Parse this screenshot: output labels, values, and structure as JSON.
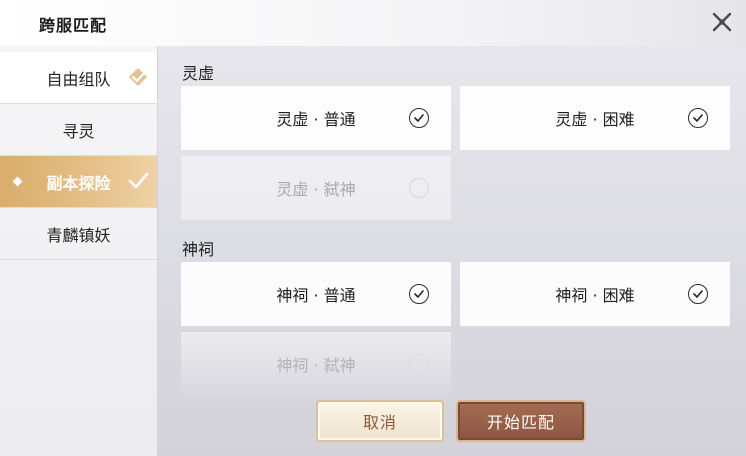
{
  "header": {
    "title": "跨服匹配",
    "close_icon": "close-icon"
  },
  "sidebar": {
    "items": [
      {
        "label": "自由组队",
        "icon": "pencil-check-icon"
      },
      {
        "label": "寻灵"
      },
      {
        "label": "副本探险",
        "icon": "check-icon",
        "active": true
      },
      {
        "label": "青麟镇妖"
      }
    ]
  },
  "sections": [
    {
      "title": "灵虚",
      "options": [
        {
          "label": "灵虚 · 普通",
          "checked": true
        },
        {
          "label": "灵虚 · 困难",
          "checked": true
        },
        {
          "label": "灵虚 · 弑神",
          "checked": false,
          "disabled": true
        }
      ]
    },
    {
      "title": "神祠",
      "options": [
        {
          "label": "神祠 · 普通",
          "checked": true
        },
        {
          "label": "神祠 · 困难",
          "checked": true
        },
        {
          "label": "神祠 · 弑神",
          "checked": false,
          "disabled": true
        }
      ]
    }
  ],
  "footer": {
    "cancel_label": "取消",
    "start_label": "开始匹配"
  },
  "colors": {
    "accent_gold": "#d9ad6a",
    "start_button": "#9a6049",
    "cancel_border": "#d9c19a"
  }
}
